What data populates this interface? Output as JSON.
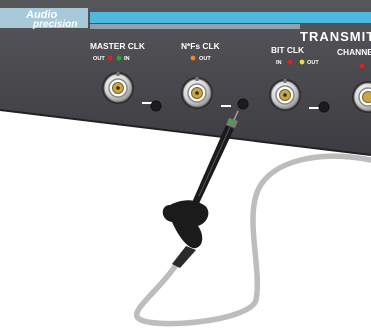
{
  "brand": {
    "line1": "Audio",
    "line2": "precision"
  },
  "section_title": "TRANSMIT",
  "connectors": [
    {
      "name": "MASTER CLK",
      "port_a": "OUT",
      "port_b": "IN",
      "led_a": "#e02020",
      "led_b": "#22aa33"
    },
    {
      "name": "N*Fs CLK",
      "port_a": "",
      "port_b": "OUT",
      "led_a": "",
      "led_b": "#f08a1c"
    },
    {
      "name": "BIT CLK",
      "port_a": "IN",
      "port_b": "OUT",
      "led_a": "#e02020",
      "led_b": "#e6e03a"
    },
    {
      "name": "CHANNEL",
      "port_a": "",
      "port_b": "",
      "led_a": "#e02020",
      "led_b": ""
    }
  ],
  "colors": {
    "panel": "#48484d",
    "accent_bar": "#4db9de",
    "brand_bg": "#a7c9da",
    "cable": "#c2c2c2",
    "probe": "#1b1b1b"
  }
}
